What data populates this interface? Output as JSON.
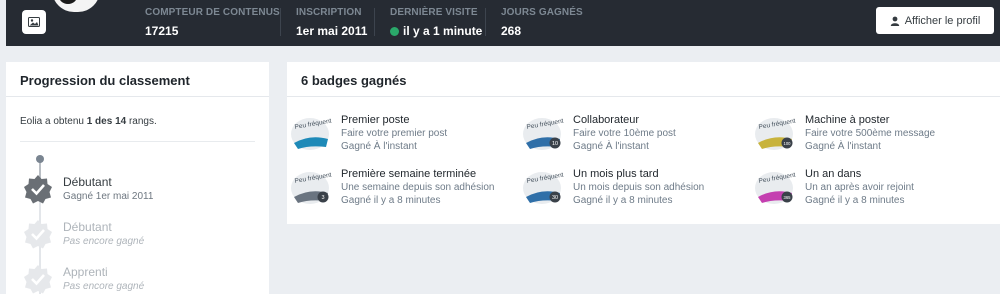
{
  "profile": {
    "stats": [
      {
        "label": "Compteur de contenus",
        "value": "17215"
      },
      {
        "label": "Inscription",
        "value": "1er mai 2011"
      },
      {
        "label": "Dernière visite",
        "value": "il y a 1 minute"
      },
      {
        "label": "Jours gagnés",
        "value": "268"
      }
    ],
    "view_profile_label": "Afficher le profil"
  },
  "ranks": {
    "title": "Progression du classement",
    "summary_prefix": "Eolia a obtenu ",
    "summary_strong": "1 des 14",
    "summary_suffix": " rangs.",
    "items": [
      {
        "title": "Débutant",
        "sub": "Gagné 1er mai 2011",
        "earned": true
      },
      {
        "title": "Débutant",
        "sub": "Pas encore gagné",
        "earned": false
      },
      {
        "title": "Apprenti",
        "sub": "Pas encore gagné",
        "earned": false
      }
    ]
  },
  "badges": {
    "title": "6 badges gagnés",
    "rarity_label": "Peu fréquent",
    "items": [
      {
        "title": "Premier poste",
        "desc": "Faire votre premier post",
        "date": "Gagné À l'instant",
        "number": "",
        "ribbon": "#1e8ab8"
      },
      {
        "title": "Collaborateur",
        "desc": "Faire votre 10ème post",
        "date": "Gagné À l'instant",
        "number": "10",
        "ribbon": "#2f6fa8"
      },
      {
        "title": "Machine à poster",
        "desc": "Faire votre 500ème message",
        "date": "Gagné À l'instant",
        "number": "100",
        "ribbon": "#c8b33c"
      },
      {
        "title": "Première semaine terminée",
        "desc": "Une semaine depuis son adhésion",
        "date": "Gagné il y a 8 minutes",
        "number": "3",
        "ribbon": "#6a7480"
      },
      {
        "title": "Un mois plus tard",
        "desc": "Un mois depuis son adhésion",
        "date": "Gagné il y a 8 minutes",
        "number": "30",
        "ribbon": "#2f6fa8"
      },
      {
        "title": "Un an dans",
        "desc": "Un an après avoir rejoint",
        "date": "Gagné il y a 8 minutes",
        "number": "365",
        "ribbon": "#c43fb0"
      }
    ]
  },
  "colors": {
    "topbar": "#262b33",
    "online": "#2aa86a",
    "accent": "#1e8ab8"
  }
}
